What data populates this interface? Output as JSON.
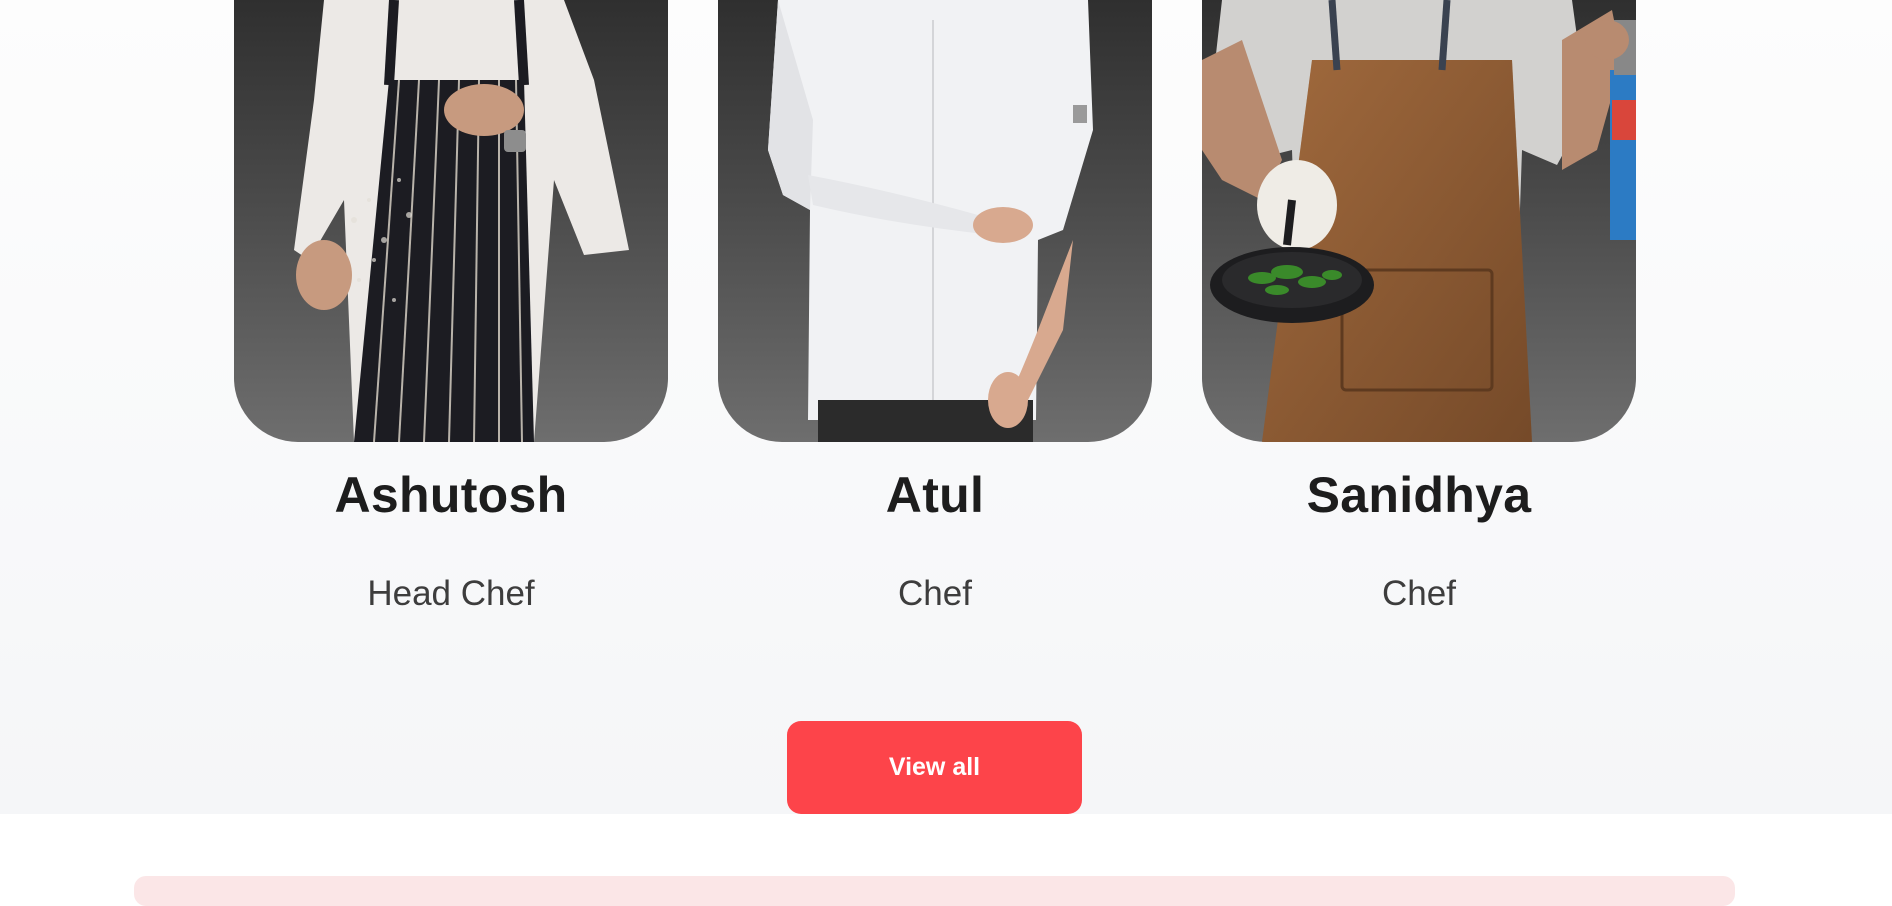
{
  "colors": {
    "accent": "#fd444a",
    "next_section_bg": "#fbe6e7",
    "name_text": "#1d1d1d",
    "role_text": "#3d3d3d"
  },
  "team": {
    "members": [
      {
        "name": "Ashutosh",
        "role": "Head Chef",
        "photo_icon": "chef-striped-apron-photo"
      },
      {
        "name": "Atul",
        "role": "Chef",
        "photo_icon": "chef-white-coat-photo"
      },
      {
        "name": "Sanidhya",
        "role": "Chef",
        "photo_icon": "chef-brown-apron-photo"
      }
    ],
    "view_all_label": "View all"
  }
}
